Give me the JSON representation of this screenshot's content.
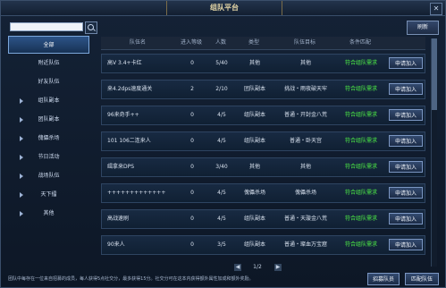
{
  "window": {
    "title": "组队平台",
    "close_icon": "close-icon"
  },
  "search": {
    "value": ""
  },
  "toolbar": {
    "refresh_label": "刷新"
  },
  "sidebar": {
    "items": [
      {
        "label": "全部",
        "selected": true,
        "arrow": false
      },
      {
        "label": "附近队伍",
        "selected": false,
        "arrow": false
      },
      {
        "label": "好友队伍",
        "selected": false,
        "arrow": false
      },
      {
        "label": "组队副本",
        "selected": false,
        "arrow": true
      },
      {
        "label": "团队副本",
        "selected": false,
        "arrow": true
      },
      {
        "label": "傀儡杀场",
        "selected": false,
        "arrow": true
      },
      {
        "label": "节日活动",
        "selected": false,
        "arrow": true
      },
      {
        "label": "战场队伍",
        "selected": false,
        "arrow": true
      },
      {
        "label": "天下擂",
        "selected": false,
        "arrow": true
      },
      {
        "label": "其他",
        "selected": false,
        "arrow": true
      }
    ]
  },
  "table": {
    "headers": [
      "队伍名",
      "进入等级",
      "人数",
      "类型",
      "队伍目标",
      "条件匹配"
    ],
    "apply_label": "申请加入",
    "rows": [
      {
        "name": "高V 3.4+卡红",
        "level": "0",
        "count": "5/40",
        "type": "其他",
        "target": "其他",
        "match": "符合组队需求"
      },
      {
        "name": "来4.2dps速度通关",
        "level": "2",
        "count": "2/10",
        "type": "团队副本",
        "target": "挑战・雨夜破天牢",
        "match": "符合组队需求"
      },
      {
        "name": "96来奇手++",
        "level": "0",
        "count": "4/5",
        "type": "组队副本",
        "target": "普通・开封金八荒",
        "match": "符合组队需求"
      },
      {
        "name": "101 106二连来人",
        "level": "0",
        "count": "4/5",
        "type": "组队副本",
        "target": "普通・卧天宫",
        "match": "符合组队需求"
      },
      {
        "name": "缉拿来DPS",
        "level": "0",
        "count": "3/40",
        "type": "其他",
        "target": "其他",
        "match": "符合组队需求"
      },
      {
        "name": "+++++++++++++",
        "level": "0",
        "count": "4/5",
        "type": "傀儡杀场",
        "target": "傀儡杀场",
        "match": "符合组队需求"
      },
      {
        "name": "高战速刷",
        "level": "0",
        "count": "4/5",
        "type": "组队副本",
        "target": "普通・天璇金八荒",
        "match": "符合组队需求"
      },
      {
        "name": "90来人",
        "level": "0",
        "count": "3/5",
        "type": "组队副本",
        "target": "普通・璨血万宝窟",
        "match": "符合组队需求"
      }
    ]
  },
  "pager": {
    "text": "1/2",
    "prev": "◀",
    "next": "▶"
  },
  "footer": {
    "tip": "团队中每存在一位来自招募的成员，每人获得5点社交分，最多获得15分。社交分可在这本内获得额外属性加成和额外奖励。",
    "recruit_label": "招募队员",
    "match_label": "匹配队伍"
  }
}
